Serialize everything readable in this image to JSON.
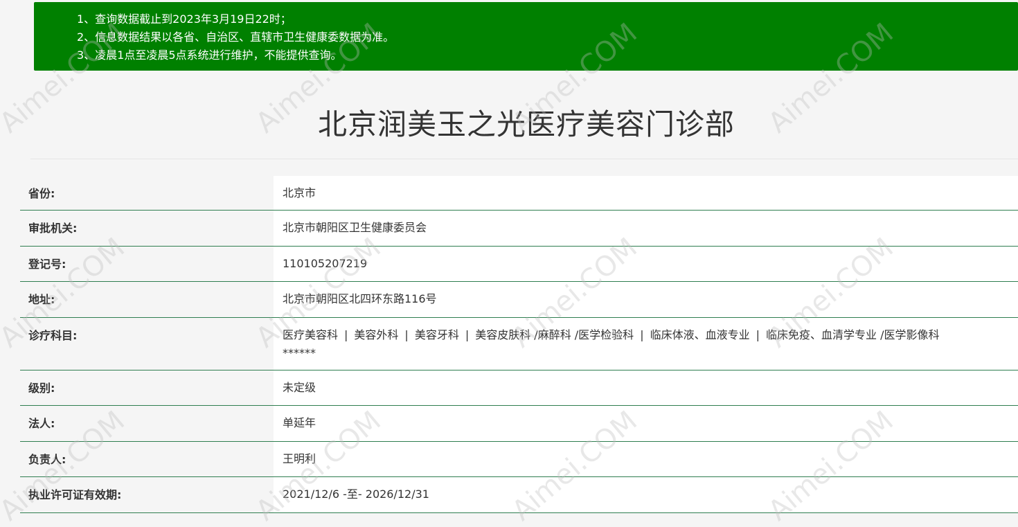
{
  "notice": {
    "lines": [
      "1、查询数据截止到2023年3月19日22时；",
      "2、信息数据结果以各省、自治区、直辖市卫生健康委数据为准。",
      "3、凌晨1点至凌晨5点系统进行维护，不能提供查询。"
    ]
  },
  "title": "北京润美玉之光医疗美容门诊部",
  "watermark": "Aimei.COM",
  "rows": [
    {
      "label": "省份:",
      "value": "北京市"
    },
    {
      "label": "审批机关:",
      "value": "北京市朝阳区卫生健康委员会"
    },
    {
      "label": "登记号:",
      "value": "110105207219"
    },
    {
      "label": "地址:",
      "value": "北京市朝阳区北四环东路116号"
    },
    {
      "label": "诊疗科目:",
      "items": [
        "医疗美容科",
        "美容外科",
        "美容牙科",
        "美容皮肤科 /麻醉科 /医学检验科",
        "临床体液、血液专业",
        "临床免疫、血清学专业 /医学影像科"
      ],
      "tail": "******"
    },
    {
      "label": "级别:",
      "value": "未定级"
    },
    {
      "label": "法人:",
      "value": "单延年"
    },
    {
      "label": "负责人:",
      "value": "王明利"
    },
    {
      "label": "执业许可证有效期:",
      "value": "2021/12/6 -至- 2026/12/31"
    }
  ]
}
